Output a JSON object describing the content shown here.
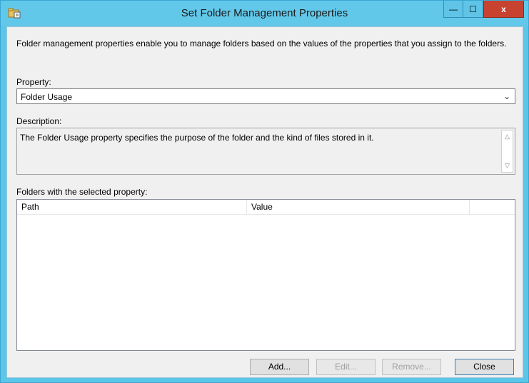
{
  "window": {
    "title": "Set Folder Management Properties",
    "min_glyph": "—",
    "max_glyph": "☐",
    "close_glyph": "x"
  },
  "intro_text": "Folder management properties enable you to manage folders based on the values of the properties that you assign to the folders.",
  "property": {
    "label": "Property:",
    "value": "Folder Usage"
  },
  "description": {
    "label": "Description:",
    "text": "The Folder Usage property specifies the purpose of the folder and the kind of files stored in it."
  },
  "folders": {
    "label": "Folders with the selected property:",
    "columns": [
      "Path",
      "Value",
      ""
    ],
    "rows": []
  },
  "buttons": {
    "add": "Add...",
    "edit": "Edit...",
    "remove": "Remove...",
    "close": "Close"
  }
}
